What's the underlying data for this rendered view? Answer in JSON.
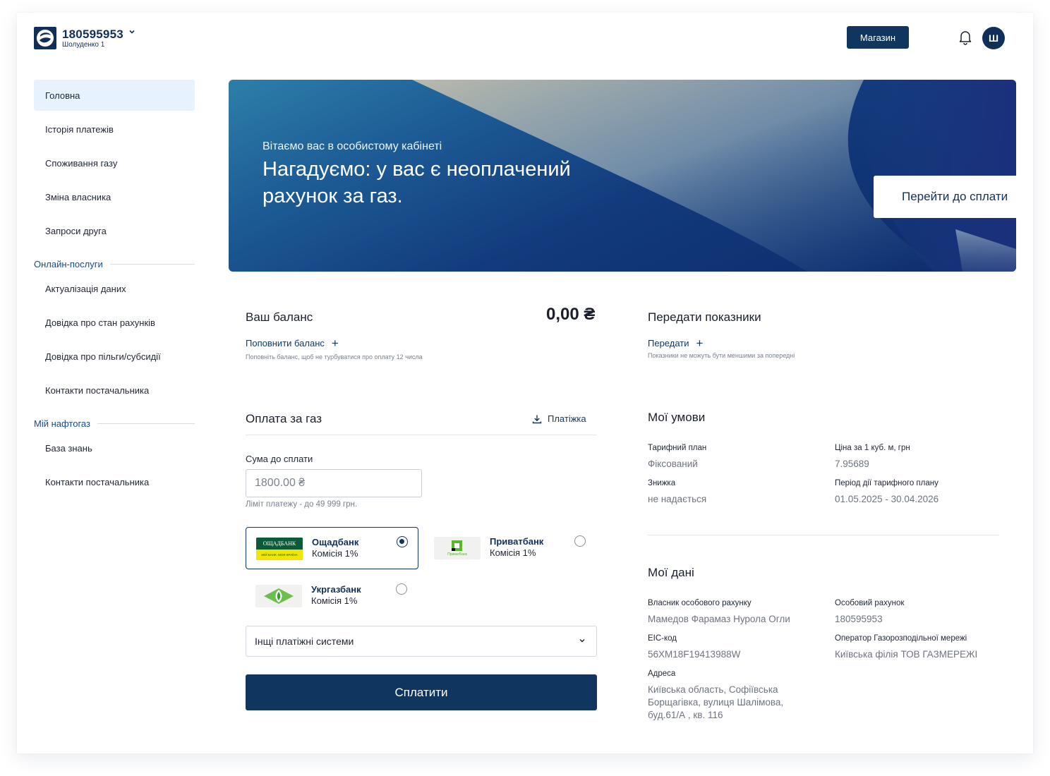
{
  "header": {
    "account_number": "180595953",
    "account_name": "Шолуденко 1",
    "shop_label": "Магазин",
    "avatar_letter": "Ш"
  },
  "sidebar": {
    "items": [
      {
        "label": "Головна",
        "active": true
      },
      {
        "label": "Історія платежів"
      },
      {
        "label": "Споживання газу"
      },
      {
        "label": "Зміна власника"
      },
      {
        "label": "Запроси друга"
      }
    ],
    "section_online": "Онлайн-послуги",
    "online_items": [
      {
        "label": "Актуалізація даних"
      },
      {
        "label": "Довідка про стан рахунків"
      },
      {
        "label": "Довідка про пільги/субсидії"
      },
      {
        "label": "Контакти постачальника"
      }
    ],
    "section_mine": "Мій нафтогаз",
    "mine_items": [
      {
        "label": "База знань"
      },
      {
        "label": "Контакти постачальника"
      }
    ]
  },
  "banner": {
    "greeting": "Вітаємо вас в особистому кабінеті",
    "title": "Нагадуємо: у вас є неоплачений рахунок за газ.",
    "cta": "Перейти до сплати"
  },
  "balance": {
    "title": "Ваш баланс",
    "value": "0,00 ₴",
    "link": "Поповнити баланс",
    "hint": "Поповніть баланс, щоб не турбуватися про оплату 12 числа"
  },
  "readings": {
    "title": "Передати показники",
    "link": "Передати",
    "hint": "Показники не можуть бути меншими за попередні"
  },
  "payment": {
    "title": "Оплата за газ",
    "receipt_link": "Платіжка",
    "amount_label": "Сума до сплати",
    "amount_value": "1800.00 ₴",
    "limit_hint": "Ліміт платежу - до 49 999 грн.",
    "banks": [
      {
        "name": "Ощадбанк",
        "commission": "Комісія 1%",
        "selected": true,
        "logo_text": "ОЩАДБАНК",
        "logo_sub": "МІЙ БАНК. МОЯ КРАЇНА"
      },
      {
        "name": "Приватбанк",
        "commission": "Комісія 1%",
        "selected": false,
        "logo_text": "ПриватБанк"
      },
      {
        "name": "Укргазбанк",
        "commission": "Комісія 1%",
        "selected": false
      }
    ],
    "other_systems": "Інщі платіжні системи",
    "pay_button": "Сплатити"
  },
  "conditions": {
    "title": "Мої умови",
    "tariff_label": "Тарифний план",
    "tariff_value": "Фіксований",
    "price_label": "Ціна за 1 куб. м, грн",
    "price_value": "7.95689",
    "discount_label": "Знижка",
    "discount_value": "не надається",
    "period_label": "Період дії тарифного плану",
    "period_value": "01.05.2025 - 30.04.2026"
  },
  "my_data": {
    "title": "Мої дані",
    "owner_label": "Власник особового рахунку",
    "owner_value": "Мамедов Фарамаз Нурола Огли",
    "account_label": "Особовий рахунок",
    "account_value": "180595953",
    "eic_label": "EIC-код",
    "eic_value": "56XM18F19413988W",
    "operator_label": "Оператор Газорозподільної мережі",
    "operator_value": "Київська філія ТОВ ГАЗМЕРЕЖІ",
    "address_label": "Адреса",
    "address_value": "Київська область, Софіївська Борщагівка, вулиця Шалімова, буд.61/А , кв. 116"
  },
  "colors": {
    "brand": "#10365f",
    "active_nav_bg": "#e6f2fd",
    "section_link": "#174a87"
  }
}
